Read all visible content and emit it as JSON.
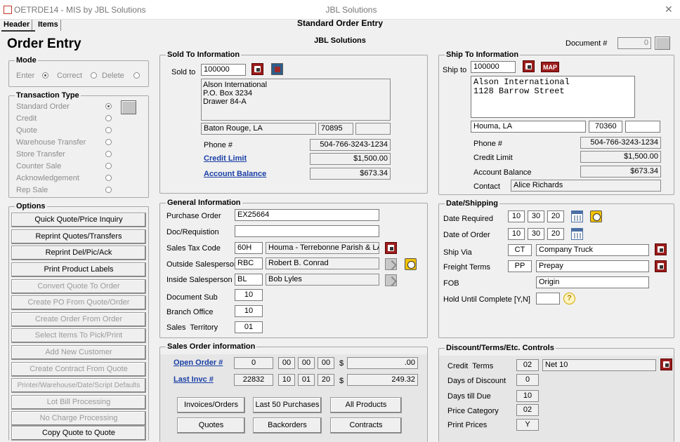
{
  "window": {
    "title": "OETRDE14 - MIS by JBL Solutions",
    "center_title": "JBL Solutions",
    "close": "✕"
  },
  "tabs": [
    "Header",
    "Items"
  ],
  "header_center": "Standard Order Entry",
  "company": "JBL Solutions",
  "page_title": "Order Entry",
  "document": {
    "label": "Document #",
    "value": "0"
  },
  "mode": {
    "title": "Mode",
    "options": [
      "Enter",
      "Correct",
      "Delete"
    ],
    "selected": "Enter"
  },
  "transaction_type": {
    "title": "Transaction Type",
    "options": [
      "Standard Order",
      "Credit",
      "Quote",
      "Warehouse Transfer",
      "Store Transfer",
      "Counter Sale",
      "Acknowledgement",
      "Rep Sale"
    ],
    "selected": "Standard Order"
  },
  "options": {
    "title": "Options",
    "buttons": [
      {
        "label": "Quick Quote/Price Inquiry",
        "enabled": true
      },
      {
        "label": "Reprint Quotes/Transfers",
        "enabled": true
      },
      {
        "label": "Reprint Del/Pic/Ack",
        "enabled": true
      },
      {
        "label": "Print Product Labels",
        "enabled": true
      },
      {
        "label": "Convert Quote To Order",
        "enabled": false
      },
      {
        "label": "Create PO From Quote/Order",
        "enabled": false
      },
      {
        "label": "Create Order From Order",
        "enabled": false
      },
      {
        "label": "Select Items To Pick/Print",
        "enabled": false
      },
      {
        "label": "Add New Customer",
        "enabled": false
      },
      {
        "label": "Create Contract From Quote",
        "enabled": false
      },
      {
        "label": "Printer/Warehouse/Date/Script Defaults",
        "enabled": false
      },
      {
        "label": "Lot Bill Processing",
        "enabled": false
      },
      {
        "label": "No Charge Processing",
        "enabled": false
      },
      {
        "label": "Copy Quote to Quote",
        "enabled": true
      }
    ]
  },
  "sold_to": {
    "title": "Sold To Information",
    "label": "Sold to",
    "customer": "100000",
    "address": [
      "Alson International",
      "P.O. Box 3234",
      "Drawer 84-A"
    ],
    "city": "Baton Rouge, LA",
    "zip": "70895",
    "extra": "",
    "phone_label": "Phone #",
    "phone": "504-766-3243-1234",
    "credit_limit_label": "Credit Limit",
    "credit_limit": "$1,500.00",
    "balance_label": "Account Balance",
    "balance": "$673.34"
  },
  "ship_to": {
    "title": "Ship To Information",
    "label": "Ship to",
    "customer": "100000",
    "map": "MAP",
    "address": [
      "Alson International",
      "1128 Barrow Street"
    ],
    "city": "Houma, LA",
    "zip": "70360",
    "extra": "",
    "phone_label": "Phone #",
    "phone": "504-766-3243-1234",
    "credit_limit_label": "Credit Limit",
    "credit_limit": "$1,500.00",
    "balance_label": "Account Balance",
    "balance": "$673.34",
    "contact_label": "Contact",
    "contact": "Alice Richards"
  },
  "general": {
    "title": "General Information",
    "po_label": "Purchase Order",
    "po": "EX25664",
    "doc_label": "Doc/Requistion",
    "doc": "",
    "tax_label": "Sales Tax Code",
    "tax_code": "60H",
    "tax_desc": "Houma - Terrebonne Parish & LA",
    "outside_label": "Outside Salesperson",
    "outside_code": "RBC",
    "outside_name": "Robert B. Conrad",
    "inside_label": "Inside Salesperson",
    "inside_code": "BL",
    "inside_name": "Bob Lyles",
    "docsub_label": "Document Sub",
    "docsub": "10",
    "branch_label": "Branch Office",
    "branch": "10",
    "territory_label": "Sales  Territory",
    "territory": "01"
  },
  "date_shipping": {
    "title": "Date/Shipping",
    "required_label": "Date Required",
    "required": [
      "10",
      "30",
      "20"
    ],
    "order_label": "Date of Order",
    "order": [
      "10",
      "30",
      "20"
    ],
    "shipvia_label": "Ship Via",
    "shipvia_code": "CT",
    "shipvia_desc": "Company Truck",
    "freight_label": "Freight Terms",
    "freight_code": "PP",
    "freight_desc": "Prepay",
    "fob_label": "FOB",
    "fob": "Origin",
    "hold_label": "Hold Until Complete [Y,N]",
    "hold": "",
    "help": "?"
  },
  "sales_order": {
    "title": "Sales Order information",
    "open_label": "Open Order #",
    "open_no": "0",
    "open_date": [
      "00",
      "00",
      "00"
    ],
    "open_currency": "$",
    "open_amount": ".00",
    "last_label": "Last Invc #",
    "last_no": "22832",
    "last_date": [
      "10",
      "01",
      "20"
    ],
    "last_currency": "$",
    "last_amount": "249.32",
    "buttons": [
      "Invoices/Orders",
      "Last 50 Purchases",
      "All Products",
      "Quotes",
      "Backorders",
      "Contracts"
    ]
  },
  "discount": {
    "title": "Discount/Terms/Etc. Controls",
    "credit_terms_label": "Credit  Terms",
    "credit_terms_code": "02",
    "credit_terms_desc": "Net 10",
    "days_discount_label": "Days of Discount",
    "days_discount": "0",
    "days_due_label": "Days till Due",
    "days_due": "10",
    "price_cat_label": "Price Category",
    "price_cat": "02",
    "print_prices_label": "Print Prices",
    "print_prices": "Y"
  }
}
